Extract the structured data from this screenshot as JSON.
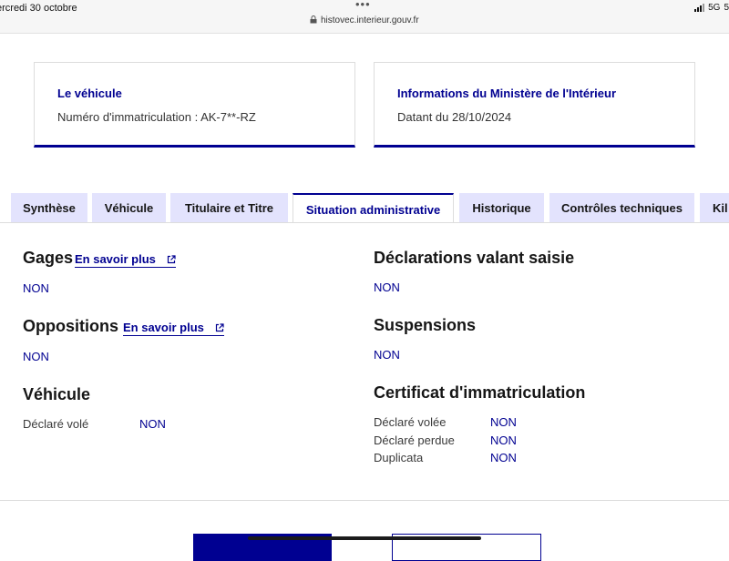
{
  "statusbar": {
    "date": "ercredi 30 octobre",
    "url": "histovec.interieur.gouv.fr",
    "network": "5G",
    "battery": "5"
  },
  "cards": {
    "vehicle": {
      "title": "Le véhicule",
      "text": "Numéro d'immatriculation : AK-7**-RZ"
    },
    "ministry": {
      "title": "Informations du Ministère de l'Intérieur",
      "text": "Datant du 28/10/2024"
    }
  },
  "tabs": [
    {
      "label": "Synthèse"
    },
    {
      "label": "Véhicule"
    },
    {
      "label": "Titulaire et Titre"
    },
    {
      "label": "Situation administrative"
    },
    {
      "label": "Historique"
    },
    {
      "label": "Contrôles techniques"
    },
    {
      "label": "Kil"
    }
  ],
  "active_tab": "Situation administrative",
  "sections": {
    "gages": {
      "title": "Gages",
      "link": "En savoir plus",
      "value": "NON"
    },
    "oppositions": {
      "title": "Oppositions",
      "link": "En savoir plus",
      "value": "NON"
    },
    "vehicule": {
      "title": "Véhicule",
      "rows": [
        {
          "label": "Déclaré volé",
          "value": "NON"
        }
      ]
    },
    "declarations": {
      "title": "Déclarations valant saisie",
      "value": "NON"
    },
    "suspensions": {
      "title": "Suspensions",
      "value": "NON"
    },
    "certificat": {
      "title": "Certificat d'immatriculation",
      "rows": [
        {
          "label": "Déclaré volée",
          "value": "NON"
        },
        {
          "label": "Déclaré perdue",
          "value": "NON"
        },
        {
          "label": "Duplicata",
          "value": "NON"
        }
      ]
    }
  },
  "colors": {
    "primary": "#000091",
    "tab_bg": "#e3e3fd",
    "border": "#dddddd"
  },
  "icons": {
    "external": "external-link-icon",
    "lock": "lock-icon"
  }
}
